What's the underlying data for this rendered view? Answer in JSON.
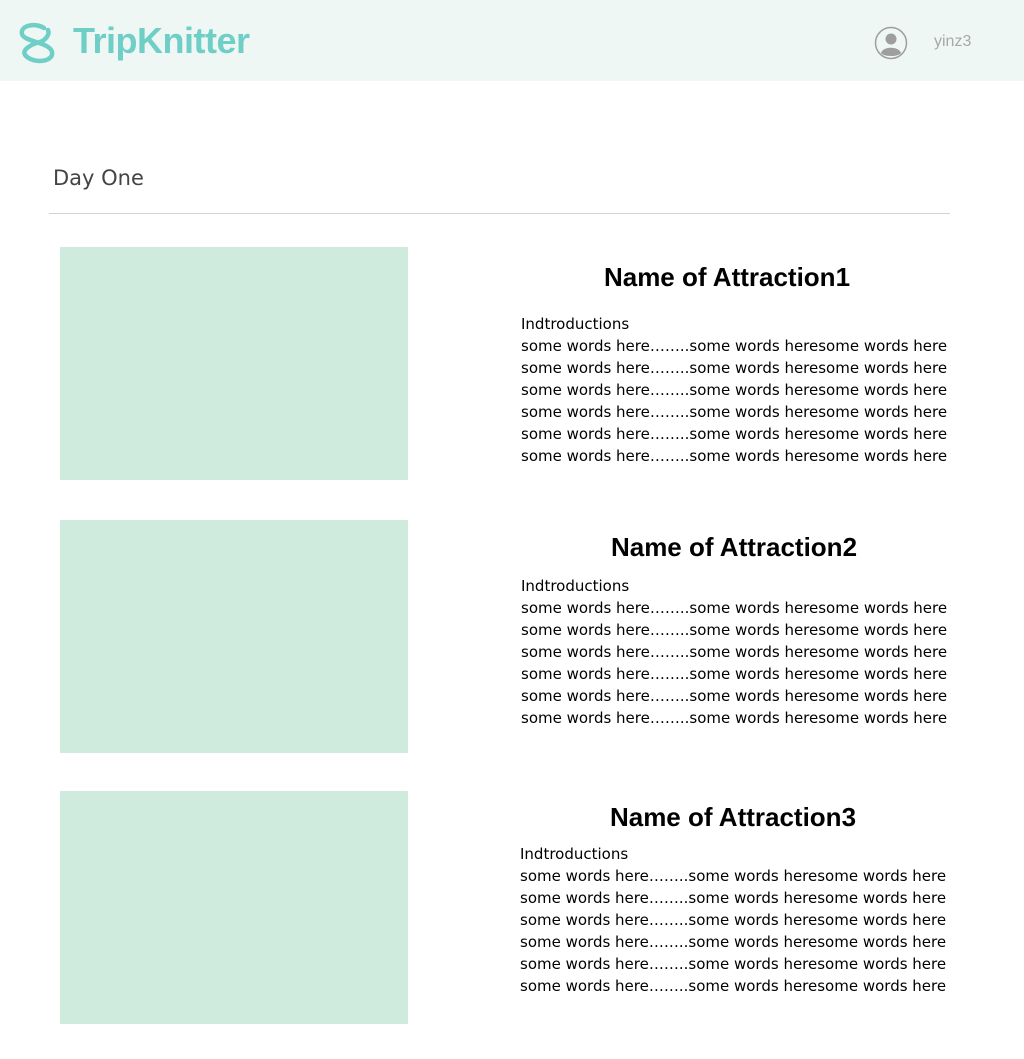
{
  "header": {
    "brand": "TripKnitter",
    "logo_icon": "s-loop-logo-icon",
    "avatar_icon": "user-circle-icon",
    "username": "yinz3",
    "colors": {
      "header_bg": "#eef7f4",
      "brand": "#6fcfc6",
      "image_placeholder": "#ceebdd"
    }
  },
  "day": {
    "title": "Day One"
  },
  "attractions": [
    {
      "name": "Name of Attraction1",
      "lines": [
        "Indtroductions",
        "some words here……..some words heresome words here",
        "some words here……..some words heresome words here",
        "some words here……..some words heresome words here",
        "some words here……..some words heresome words here",
        "some words here……..some words heresome words here",
        "some words here……..some words heresome words here"
      ]
    },
    {
      "name": "Name of Attraction2",
      "lines": [
        "Indtroductions",
        "some words here……..some words heresome words here",
        "some words here……..some words heresome words here",
        "some words here……..some words heresome words here",
        "some words here……..some words heresome words here",
        "some words here……..some words heresome words here",
        "some words here……..some words heresome words here"
      ]
    },
    {
      "name": "Name of Attraction3",
      "lines": [
        "Indtroductions",
        "some words here……..some words heresome words here",
        "some words here……..some words heresome words here",
        "some words here……..some words heresome words here",
        "some words here……..some words heresome words here",
        "some words here……..some words heresome words here",
        "some words here……..some words heresome words here"
      ]
    }
  ]
}
